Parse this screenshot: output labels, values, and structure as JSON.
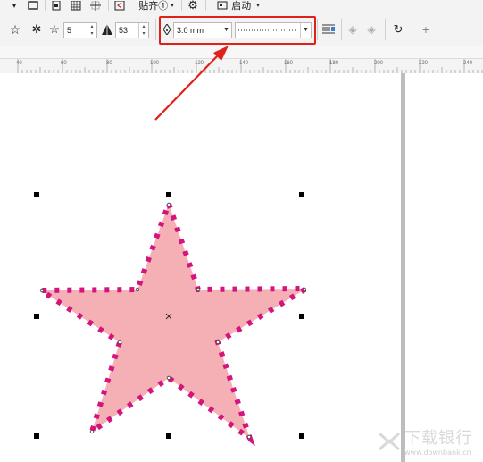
{
  "toolbar_top": {
    "snap_label": "贴齐①",
    "launch_label": "启动"
  },
  "property_bar": {
    "points_value": "5",
    "sharpness_value": "53",
    "outline_width": "3.0 mm",
    "outline_style": "dotted"
  },
  "ruler": {
    "labels": [
      "40",
      "60",
      "80",
      "100",
      "120",
      "140",
      "160",
      "180",
      "200",
      "220",
      "240"
    ]
  },
  "shape": {
    "fill_color": "#f4b0b4",
    "outline_color": "#d4157d"
  },
  "watermark": {
    "text": "下载银行",
    "site": "www.downbank.cn"
  }
}
